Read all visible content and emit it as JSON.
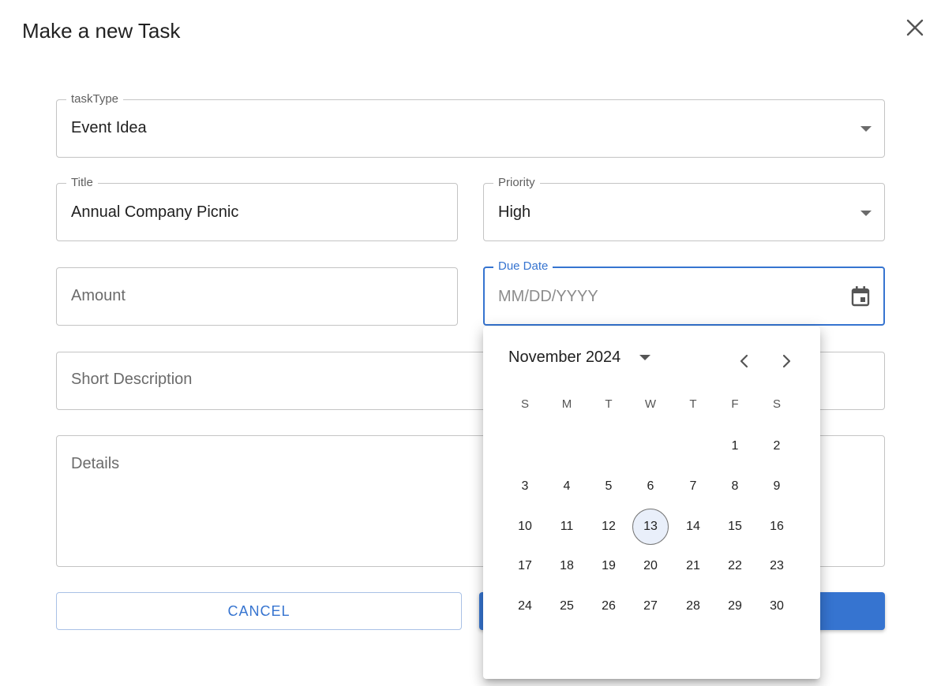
{
  "dialog": {
    "title": "Make a new Task"
  },
  "form": {
    "task_type": {
      "label": "taskType",
      "value": "Event Idea"
    },
    "title": {
      "label": "Title",
      "value": "Annual Company Picnic"
    },
    "priority": {
      "label": "Priority",
      "value": "High"
    },
    "amount": {
      "placeholder": "Amount"
    },
    "due_date": {
      "label": "Due Date",
      "placeholder": "MM/DD/YYYY"
    },
    "short_description": {
      "placeholder": "Short Description"
    },
    "details": {
      "placeholder": "Details"
    }
  },
  "buttons": {
    "cancel": "CANCEL"
  },
  "calendar": {
    "month_label": "November 2024",
    "weekdays": [
      "S",
      "M",
      "T",
      "W",
      "T",
      "F",
      "S"
    ],
    "weeks": [
      [
        "",
        "",
        "",
        "",
        "",
        "1",
        "2"
      ],
      [
        "3",
        "4",
        "5",
        "6",
        "7",
        "8",
        "9"
      ],
      [
        "10",
        "11",
        "12",
        "13",
        "14",
        "15",
        "16"
      ],
      [
        "17",
        "18",
        "19",
        "20",
        "21",
        "22",
        "23"
      ],
      [
        "24",
        "25",
        "26",
        "27",
        "28",
        "29",
        "30"
      ]
    ],
    "today": "13"
  },
  "colors": {
    "accent": "#3674d0",
    "border": "#c4c4c4",
    "today_bg": "#e9effa"
  },
  "icons": {
    "close": "close-icon",
    "calendar": "calendar-icon",
    "dropdown": "caret-down-icon",
    "prev": "chevron-left-icon",
    "next": "chevron-right-icon"
  }
}
